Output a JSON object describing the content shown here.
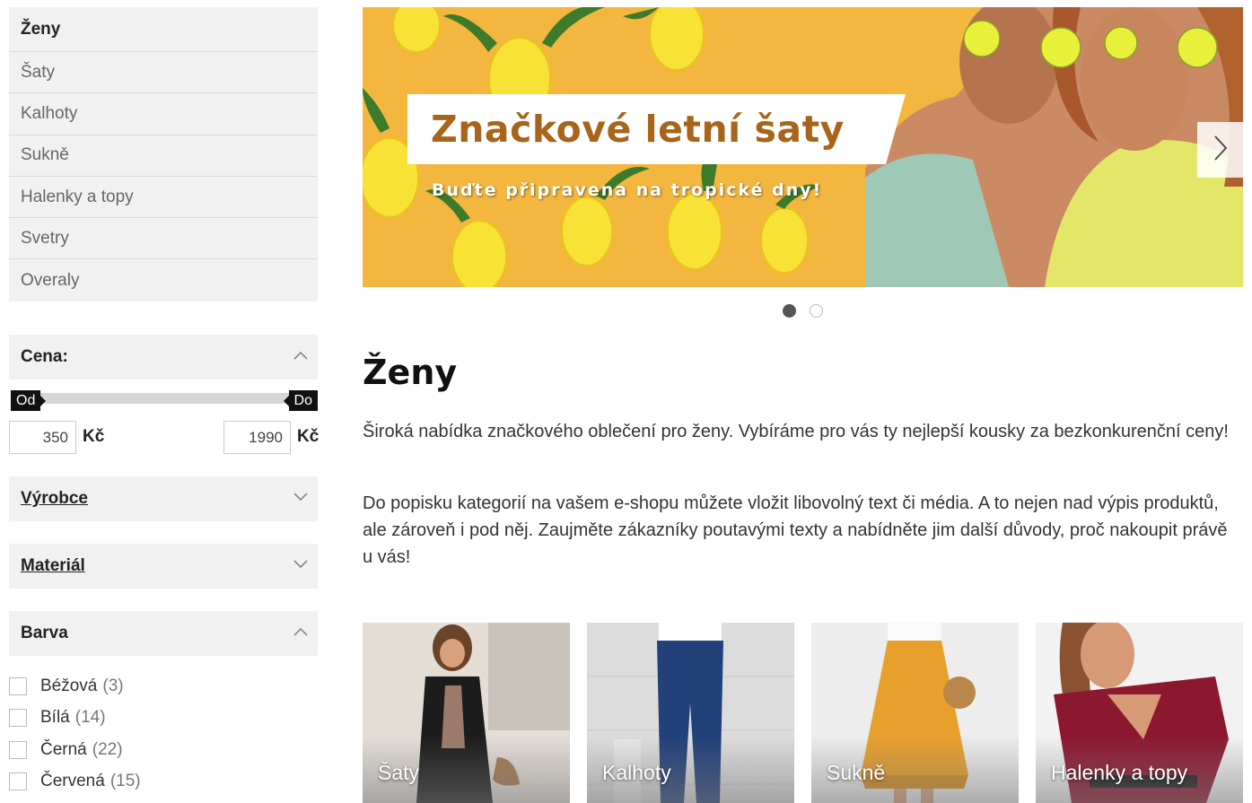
{
  "categories": {
    "heading": "Ženy",
    "items": [
      "Šaty",
      "Kalhoty",
      "Sukně",
      "Halenky a topy",
      "Svetry",
      "Overaly"
    ]
  },
  "filters": {
    "price": {
      "label": "Cena:",
      "from_tag": "Od",
      "to_tag": "Do",
      "min_value": "350",
      "max_value": "1990",
      "currency": "Kč",
      "expanded": true
    },
    "manufacturer": {
      "label": "Výrobce",
      "expanded": false
    },
    "material": {
      "label": "Materiál",
      "expanded": false
    },
    "color": {
      "label": "Barva",
      "expanded": true,
      "options": [
        {
          "name": "Béžová",
          "count": "(3)"
        },
        {
          "name": "Bílá",
          "count": "(14)"
        },
        {
          "name": "Černá",
          "count": "(22)"
        },
        {
          "name": "Červená",
          "count": "(15)"
        }
      ]
    }
  },
  "banner": {
    "title": "Značkové letní šaty",
    "subtitle": "Buďte připravena na tropické dny!",
    "next_icon": "chevron-right-icon",
    "slides": 2,
    "active_slide": 1,
    "colors": {
      "background": "#f3b73f",
      "title": "#a8641a"
    }
  },
  "main": {
    "title": "Ženy",
    "paragraphs": [
      "Široká nabídka značkového oblečení pro ženy. Vybíráme pro vás ty nejlepší kousky za bezkonkurenční ceny!",
      "Do popisku kategorií na vašem e-shopu můžete vložit libovolný text či média. A to nejen nad výpis produktů, ale zároveň i pod něj. Zaujměte zákazníky poutavými texty a nabídněte jim další důvody, proč nakoupit právě u vás!"
    ],
    "tiles": [
      "Šaty",
      "Kalhoty",
      "Sukně",
      "Halenky a topy"
    ]
  }
}
